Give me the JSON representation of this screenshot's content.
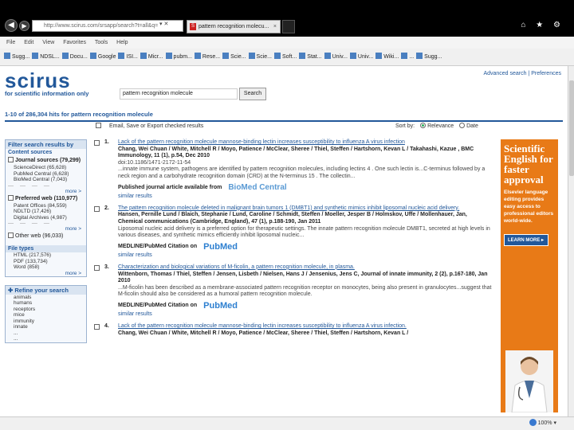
{
  "browser": {
    "address": "http://www.scirus.com/srsapp/search?t=all&q=",
    "tab_title": "pattern recognition molecu...",
    "tab_close": "×",
    "nav_back": "◀",
    "nav_forward": "▶",
    "window_controls": "⌂ ★ ⚙",
    "menu": [
      "File",
      "Edit",
      "View",
      "Favorites",
      "Tools",
      "Help"
    ],
    "favorites": [
      "Sugg...",
      "NDSL...",
      "Docu...",
      "Google",
      "ISI...",
      "Micr...",
      "pubm...",
      "Rese...",
      "Scie...",
      "Scie...",
      "Soft...",
      "Stat...",
      "Univ...",
      "Univ...",
      "Wiki...",
      "...",
      "Sugg..."
    ],
    "zoom": "100%"
  },
  "site": {
    "logo": "scirus",
    "tagline": "for scientific information only",
    "search_value": "pattern recognition molecule",
    "search_button": "Search",
    "advanced_search": "Advanced search",
    "preferences": "Preferences",
    "hits_text": "1-10 of 286,304 hits for pattern recognition molecule",
    "email_text": "Email, Save or Export checked results",
    "sort_label": "Sort by:",
    "sort_relevance": "Relevance",
    "sort_date": "Date"
  },
  "sidebar": {
    "filter_title": "Filter search results by",
    "content_sources": "Content sources",
    "journal_sources": "Journal sources (79,299)",
    "journal_items": [
      "ScienceDirect (65,628)",
      "PubMed Central (6,628)",
      "BioMed Central (7,043)"
    ],
    "more1": "more >",
    "preferred_web": "Preferred web (110,977)",
    "preferred_items": [
      "Patent Offices (84,559)",
      "NDLTD (17,426)",
      "Digital Archives (4,987)"
    ],
    "more2": "more >",
    "other_web": "Other web (96,033)",
    "file_types": "File types",
    "file_items": [
      "HTML (217,576)",
      "PDF (133,734)",
      "Word (858)"
    ],
    "more3": "more >",
    "refine_title": "Refine your search",
    "refine_items": [
      "animals",
      "humans",
      "receptors",
      "mice",
      "immunity",
      "innate",
      "...",
      "..."
    ]
  },
  "results": [
    {
      "num": "1.",
      "title": "Lack of the pattern recognition molecule mannose-binding lectin increases susceptibility to influenza A virus infection",
      "authors": "Chang, Wei Chuan / White, Mitchell R / Moyo, Patience / McClear, Sheree / Thiel, Steffen / Hartshorn, Kevan L / Takahashi, Kazue , BMC Immunology, 11 (1), p.54, Dec 2010",
      "doi": "doi:10.1186/1471-2172-11-54",
      "snippet": "...innate immune system, pathogens are identified by pattern recognition molecules, including lectins 4 . One such lectin is...C-terminus followed by a neck region and a carbohydrate recognition domain (CRD) at the N-terminus 15 . The collectin...",
      "published": "Published journal article available from",
      "source_logo": "BioMed Central",
      "similar": "similar results"
    },
    {
      "num": "2.",
      "title": "The pattern recognition molecule deleted in malignant brain tumors 1 (DMBT1) and synthetic mimics inhibit liposomal nucleic acid delivery.",
      "authors": "Hansen, Pernille Lund / Blaich, Stephanie / Lund, Caroline / Schmidt, Steffen / Moeller, Jesper B / Holmskov, Uffe / Mollenhauer, Jan, Chemical communications (Cambridge, England), 47 (1), p.188-190, Jan 2011",
      "snippet": "Liposomal nucleic acid delivery is a preferred option for therapeutic settings. The innate pattern recognition molecule DMBT1, secreted at high levels in various diseases, and synthetic mimics efficiently inhibit liposomal nucleic...",
      "published": "MEDLINE/PubMed Citation on",
      "source_logo": "PubMed",
      "similar": "similar results"
    },
    {
      "num": "3.",
      "title": "Characterization and biological variations of M-ficolin, a pattern recognition molecule, in plasma.",
      "authors": "Wittenborn, Thomas / Thiel, Steffen / Jensen, Lisbeth / Nielsen, Hans J / Jensenius, Jens C, Journal of innate immunity, 2 (2), p.167-180, Jan 2010",
      "snippet": "...M-ficolin has been described as a membrane-associated pattern recognition receptor on monocytes, being also present in granulocytes...suggest that M-ficolin should also be considered as a humoral pattern recognition molecule.",
      "published": "MEDLINE/PubMed Citation on",
      "source_logo": "PubMed",
      "similar": "similar results"
    },
    {
      "num": "4.",
      "title": "Lack of the pattern recognition molecule mannose-binding lectin increases susceptibility to influenza A virus infection.",
      "authors": "Chang, Wei Chuan / White, Mitchell R / Moyo, Patience / McClear, Sheree / Thiel, Steffen / Hartshorn, Kevan L /"
    }
  ],
  "ad": {
    "headline": "Scientific English for faster approval",
    "text": "Elsevier language editing provides easy access to professional editors world-wide.",
    "button": "LEARN MORE ▸"
  },
  "colors": {
    "brand": "#22589a",
    "ad": "#e87a17"
  }
}
